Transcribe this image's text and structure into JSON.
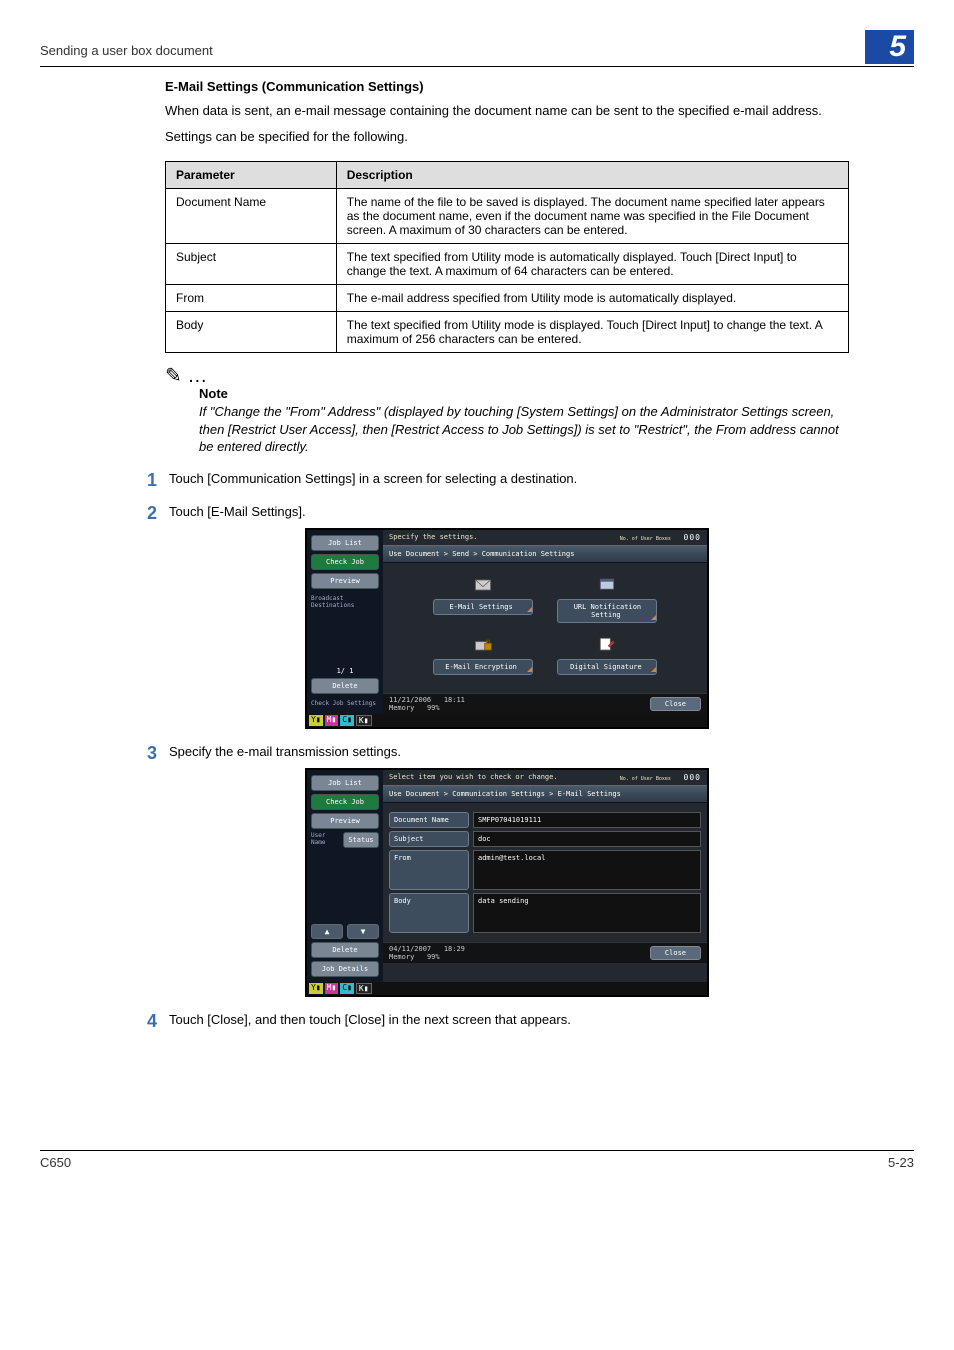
{
  "header": {
    "left": "Sending a user box document",
    "chapter": "5"
  },
  "section_title": "E-Mail Settings (Communication Settings)",
  "intro_1": "When data is sent, an e-mail message containing the document name can be sent to the specified e-mail address.",
  "intro_2": "Settings can be specified for the following.",
  "table": {
    "head_param": "Parameter",
    "head_desc": "Description",
    "rows": [
      {
        "p": "Document Name",
        "d": "The name of the file to be saved is displayed. The document name specified later appears as the document name, even if the document name was specified in the File Document screen. A maximum of 30 characters can be entered."
      },
      {
        "p": "Subject",
        "d": "The text specified from Utility mode is automatically displayed. Touch [Direct Input] to change the text. A maximum of 64 characters can be entered."
      },
      {
        "p": "From",
        "d": "The e-mail address specified from Utility mode is automatically displayed."
      },
      {
        "p": "Body",
        "d": "The text specified from Utility mode is displayed. Touch [Direct Input] to change the text. A maximum of 256 characters can be entered."
      }
    ]
  },
  "note": {
    "label": "Note",
    "text": "If \"Change the \"From\" Address\" (displayed by touching [System Settings] on the Administrator Settings screen, then [Restrict User Access], then [Restrict Access to Job Settings]) is set to \"Restrict\", the From address cannot be entered directly."
  },
  "steps": {
    "s1": "Touch [Communication Settings] in a screen for selecting a destination.",
    "s2": "Touch [E-Mail Settings].",
    "s3": "Specify the e-mail transmission settings.",
    "s4": "Touch [Close], and then touch [Close] in the next screen that appears."
  },
  "screen1": {
    "top_instruction": "Specify the settings.",
    "counter": "000",
    "counter_label": "No. of User Boxes",
    "breadcrumb": "Use Document > Send > Communication Settings",
    "side": {
      "job_list": "Job List",
      "check_job": "Check Job",
      "preview": "Preview",
      "bcast": "Broadcast Destinations",
      "page": "1/  1",
      "delete": "Delete",
      "check_settings": "Check Job Settings"
    },
    "tiles": {
      "email_settings": "E-Mail Settings",
      "url_notification": "URL Notification Setting",
      "email_encryption": "E-Mail Encryption",
      "digital_signature": "Digital Signature"
    },
    "foot": {
      "date": "11/21/2006",
      "time": "18:11",
      "mem": "Memory",
      "mempct": "99%",
      "close": "Close"
    }
  },
  "screen2": {
    "top_instruction": "Select item you wish to check or change.",
    "counter": "000",
    "counter_label": "No. of User Boxes",
    "breadcrumb": "Use Document > Communication Settings > E-Mail Settings",
    "side": {
      "job_list": "Job List",
      "check_job": "Check Job",
      "preview": "Preview",
      "user_name": "User Name",
      "status": "Status",
      "delete": "Delete",
      "details": "Job Details"
    },
    "fields": {
      "doc_name_label": "Document Name",
      "doc_name_val": "SMFP07041019111",
      "subject_label": "Subject",
      "subject_val": "doc",
      "from_label": "From",
      "from_val": "admin@test.local",
      "body_label": "Body",
      "body_val": "data sending"
    },
    "foot": {
      "date": "04/11/2007",
      "time": "18:29",
      "mem": "Memory",
      "mempct": "99%",
      "close": "Close"
    }
  },
  "footer": {
    "left": "C650",
    "right": "5-23"
  }
}
